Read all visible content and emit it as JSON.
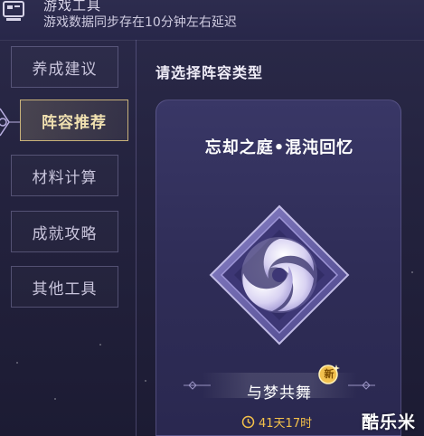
{
  "header": {
    "title": "游戏工具",
    "subtitle": "游戏数据同步存在10分钟左右延迟"
  },
  "sidebar": {
    "items": [
      {
        "label": "养成建议",
        "active": false
      },
      {
        "label": "阵容推荐",
        "active": true
      },
      {
        "label": "材料计算",
        "active": false
      },
      {
        "label": "成就攻略",
        "active": false
      },
      {
        "label": "其他工具",
        "active": false
      }
    ]
  },
  "main": {
    "section_title": "请选择阵容类型",
    "card": {
      "title": "忘却之庭•混沌回忆",
      "emblem_icon": "memory-of-chaos-emblem-icon",
      "mode_label": "与梦共舞",
      "new_badge": "新",
      "timer_icon": "clock-icon",
      "timer_text": "41天17时"
    }
  },
  "watermark": "酷乐米",
  "colors": {
    "background": "#24233f",
    "card": "#353363",
    "active_border": "#c9b27a",
    "timer": "#f3c04a"
  }
}
